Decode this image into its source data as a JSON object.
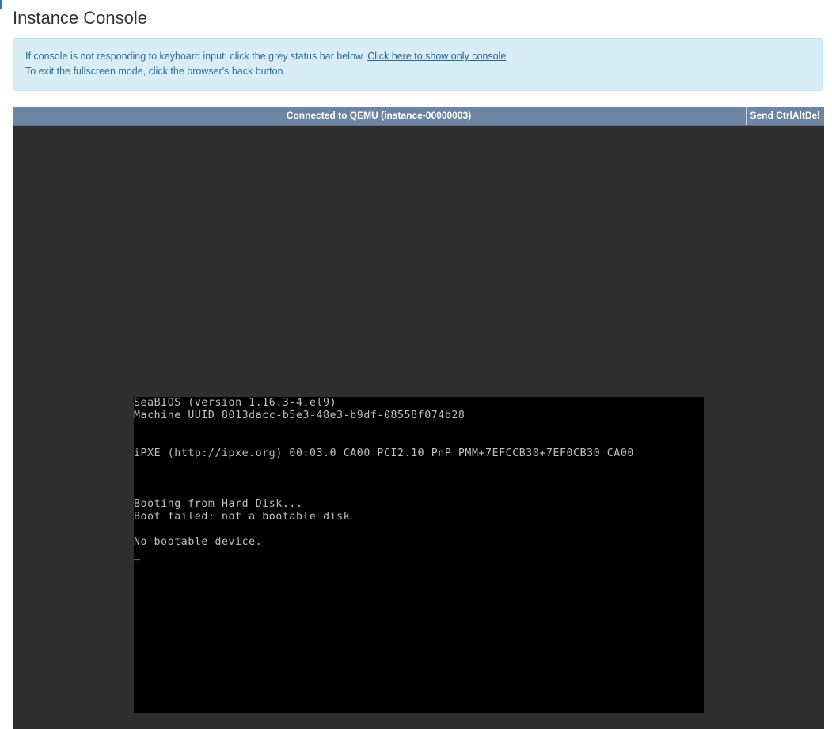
{
  "page": {
    "title": "Instance Console"
  },
  "info": {
    "line1_prefix": "If console is not responding to keyboard input: click the grey status bar below.",
    "link_text": "Click here to show only console",
    "line2": "To exit the fullscreen mode, click the browser's back button."
  },
  "console": {
    "status_text": "Connected to QEMU (instance-00000003)",
    "send_cad_label": "Send CtrlAltDel",
    "screen_lines": [
      "SeaBIOS (version 1.16.3-4.el9)",
      "Machine UUID 8013dacc-b5e3-48e3-b9df-08558f074b28",
      "",
      "",
      "iPXE (http://ipxe.org) 00:03.0 CA00 PCI2.10 PnP PMM+7EFCCB30+7EF0CB30 CA00",
      "",
      "",
      "",
      "Booting from Hard Disk...",
      "Boot failed: not a bootable disk",
      "",
      "No bootable device.",
      "_"
    ]
  },
  "colors": {
    "info_bg": "#d9edf7",
    "status_bar": "#6e84a3",
    "console_bg": "#2e2e2e",
    "screen_bg": "#000000",
    "screen_text": "#c0c0c0"
  }
}
